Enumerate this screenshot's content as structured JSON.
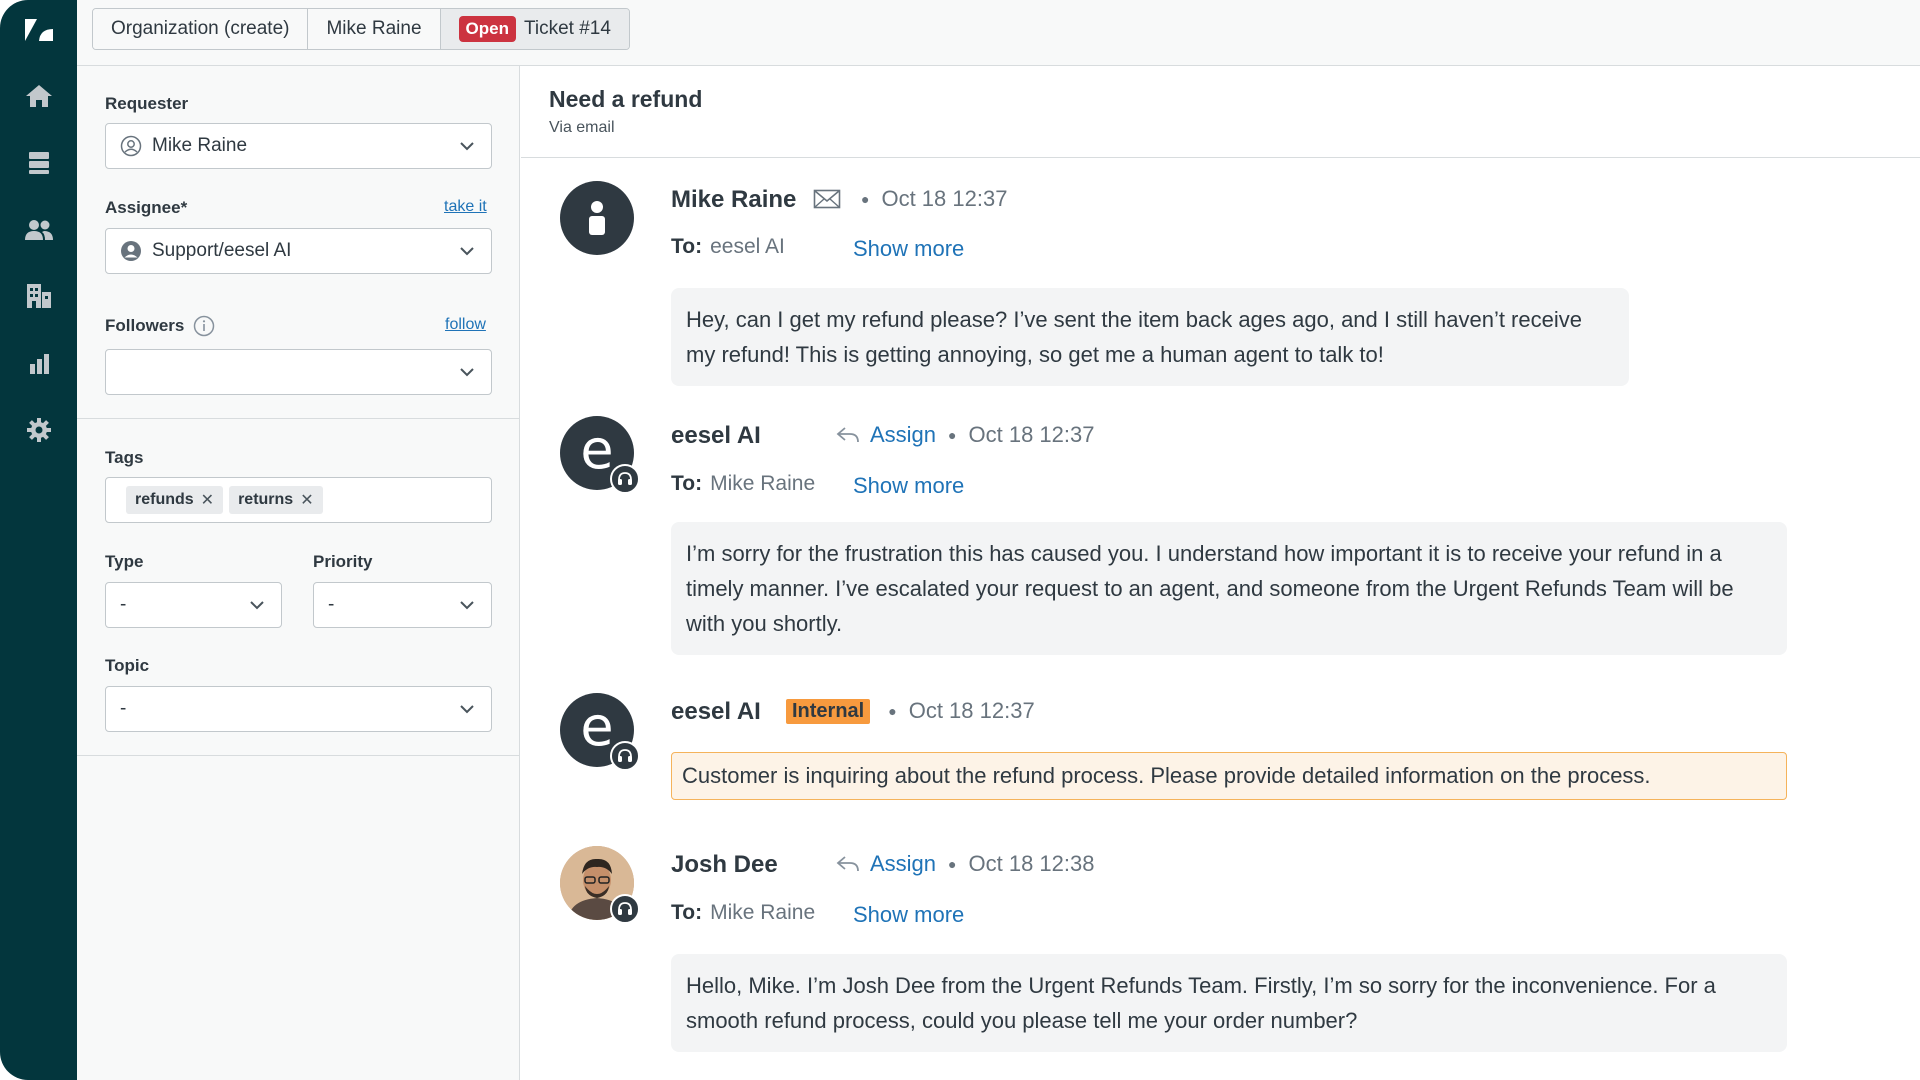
{
  "colors": {
    "rail": "#03363d",
    "accent": "#1f73b7",
    "open": "#cc3340",
    "internal": "#f79a3e"
  },
  "nav": {
    "items": [
      {
        "name": "logo-icon"
      },
      {
        "name": "home-icon"
      },
      {
        "name": "views-icon"
      },
      {
        "name": "customers-icon"
      },
      {
        "name": "organizations-icon"
      },
      {
        "name": "reporting-icon"
      },
      {
        "name": "settings-icon"
      }
    ]
  },
  "tabs": {
    "organization": "Organization (create)",
    "user": "Mike Raine",
    "status": "Open",
    "ticket": "Ticket #14"
  },
  "properties": {
    "requester_label": "Requester",
    "requester_value": "Mike Raine",
    "assignee_label": "Assignee*",
    "assignee_link": "take it",
    "assignee_value": "Support/eesel AI",
    "followers_label": "Followers",
    "followers_link": "follow",
    "followers_value": "",
    "tags_label": "Tags",
    "tags": [
      "refunds",
      "returns"
    ],
    "type_label": "Type",
    "type_value": "-",
    "priority_label": "Priority",
    "priority_value": "-",
    "topic_label": "Topic",
    "topic_value": "-"
  },
  "conversation": {
    "subject": "Need a refund",
    "channel": "Via email",
    "messages": [
      {
        "author": "Mike Raine",
        "time": "Oct 18 12:37",
        "to_label": "To:",
        "to": "eesel AI",
        "show_more": "Show more",
        "body": "Hey, can I get my refund please? I’ve sent the item back ages ago, and I still haven’t receive my refund! This is getting annoying, so get me a human agent to talk to!"
      },
      {
        "author": "eesel AI",
        "avatar_letter": "e",
        "assign": "Assign",
        "time": "Oct 18 12:37",
        "to_label": "To:",
        "to": "Mike Raine",
        "show_more": "Show more",
        "body": "I’m sorry for the frustration this has caused you. I understand how important it is to receive your refund in a timely manner. I’ve escalated your request to an agent, and someone from the Urgent Refunds Team will be with you shortly."
      },
      {
        "author": "eesel AI",
        "avatar_letter": "e",
        "badge": "Internal",
        "time": "Oct 18 12:37",
        "body": "Customer is inquiring about the refund process. Please provide detailed information on the process."
      },
      {
        "author": "Josh Dee",
        "assign": "Assign",
        "time": "Oct 18 12:38",
        "to_label": "To:",
        "to": "Mike Raine",
        "show_more": "Show more",
        "body": "Hello, Mike. I’m Josh Dee from the Urgent Refunds Team. Firstly, I’m so sorry for the inconvenience. For a smooth refund process, could you please tell me your order number?"
      }
    ]
  }
}
